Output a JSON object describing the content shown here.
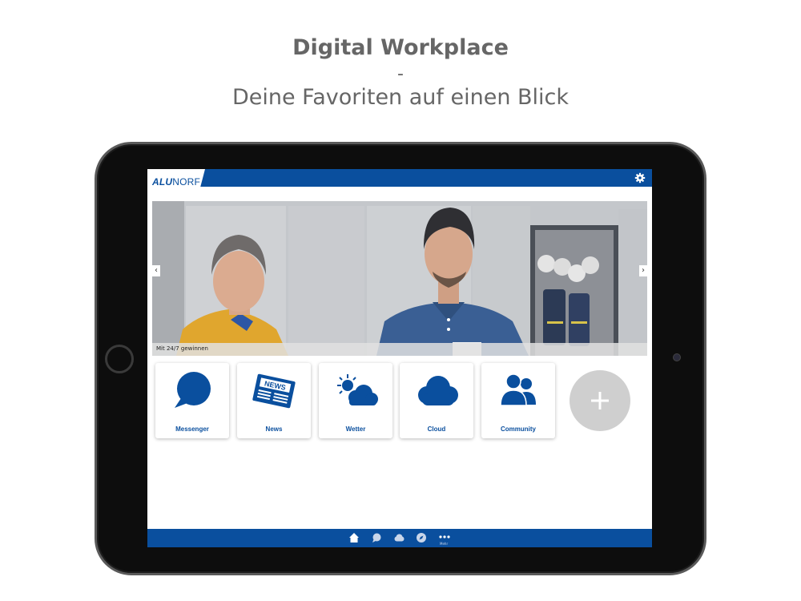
{
  "header": {
    "title": "Digital Workplace",
    "dash": "-",
    "subtitle": "Deine Favoriten auf einen Blick"
  },
  "app": {
    "logo_bold": "ALU",
    "logo_regular": "NORF",
    "brand_color": "#0a4f9e",
    "top_icon": "gear-icon"
  },
  "slider": {
    "caption": "Mit 24/7 gewinnen",
    "prev_icon": "chevron-left-icon",
    "next_icon": "chevron-right-icon"
  },
  "tiles": [
    {
      "label": "Messenger",
      "icon": "chat-bubble-icon"
    },
    {
      "label": "News",
      "icon": "newspaper-icon"
    },
    {
      "label": "Wetter",
      "icon": "weather-icon"
    },
    {
      "label": "Cloud",
      "icon": "cloud-icon"
    },
    {
      "label": "Community",
      "icon": "people-icon"
    }
  ],
  "add_button": {
    "icon": "plus-icon",
    "color": "#cfcfcf"
  },
  "bottom_nav": {
    "items": [
      "home-icon",
      "chat-icon",
      "cloud-icon",
      "compass-icon",
      "more-icon"
    ],
    "more_label": "Mehr"
  }
}
